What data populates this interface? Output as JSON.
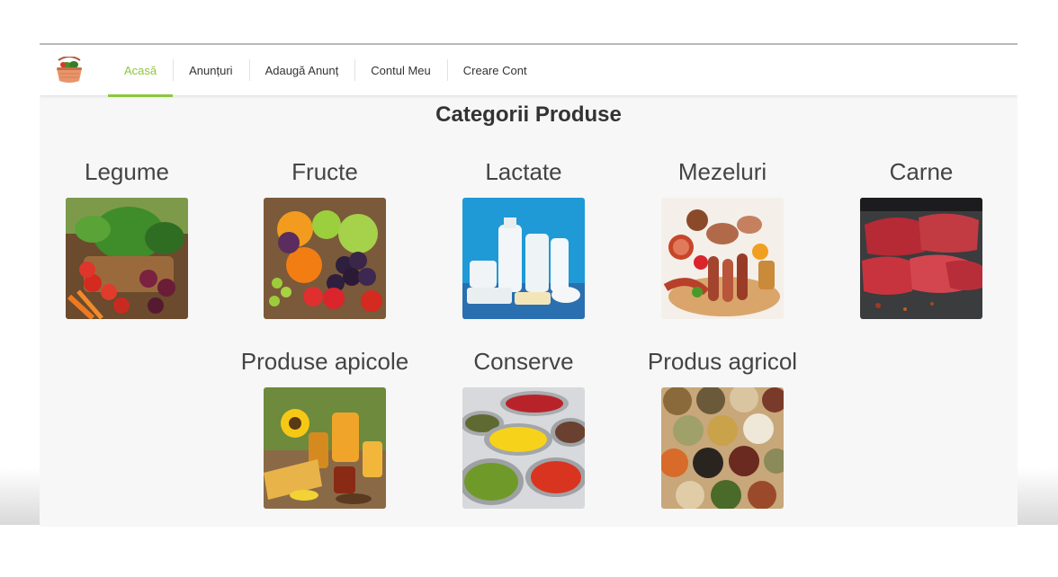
{
  "nav": {
    "logo": "basket-logo-icon",
    "items": [
      {
        "label": "Acasă",
        "active": true
      },
      {
        "label": "Anunțuri",
        "active": false
      },
      {
        "label": "Adaugă Anunț",
        "active": false
      },
      {
        "label": "Contul Meu",
        "active": false
      },
      {
        "label": "Creare Cont",
        "active": false
      }
    ]
  },
  "page": {
    "title": "Categorii Produse"
  },
  "categories": [
    {
      "label": "Legume",
      "image": "vegetables-photo"
    },
    {
      "label": "Fructe",
      "image": "fruits-photo"
    },
    {
      "label": "Lactate",
      "image": "dairy-photo"
    },
    {
      "label": "Mezeluri",
      "image": "cold-cuts-photo"
    },
    {
      "label": "Carne",
      "image": "meat-photo"
    },
    {
      "label": "Produse apicole",
      "image": "bee-products-photo"
    },
    {
      "label": "Conserve",
      "image": "canned-food-photo"
    },
    {
      "label": "Produs agricol",
      "image": "grains-seeds-photo"
    }
  ],
  "colors": {
    "accent": "#8cc63f",
    "text": "#333333",
    "background": "#f7f7f7"
  }
}
